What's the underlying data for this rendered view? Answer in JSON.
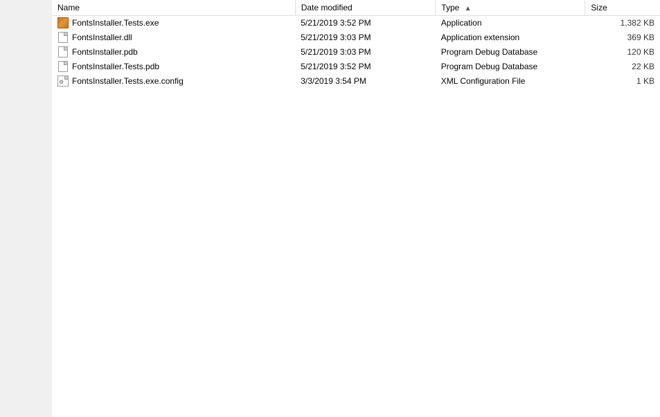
{
  "columns": [
    {
      "id": "name",
      "label": "Name",
      "sortable": true,
      "sorted": false,
      "sort_dir": ""
    },
    {
      "id": "date",
      "label": "Date modified",
      "sortable": true,
      "sorted": false,
      "sort_dir": ""
    },
    {
      "id": "type",
      "label": "Type",
      "sortable": true,
      "sorted": true,
      "sort_dir": "asc"
    },
    {
      "id": "size",
      "label": "Size",
      "sortable": true,
      "sorted": false,
      "sort_dir": ""
    }
  ],
  "files": [
    {
      "name": "FontsInstaller.Tests.exe",
      "icon": "exe",
      "date": "5/21/2019 3:52 PM",
      "type": "Application",
      "size": "1,382 KB"
    },
    {
      "name": "FontsInstaller.dll",
      "icon": "dll",
      "date": "5/21/2019 3:03 PM",
      "type": "Application extension",
      "size": "369 KB"
    },
    {
      "name": "FontsInstaller.pdb",
      "icon": "pdb",
      "date": "5/21/2019 3:03 PM",
      "type": "Program Debug Database",
      "size": "120 KB"
    },
    {
      "name": "FontsInstaller.Tests.pdb",
      "icon": "pdb",
      "date": "5/21/2019 3:52 PM",
      "type": "Program Debug Database",
      "size": "22 KB"
    },
    {
      "name": "FontsInstaller.Tests.exe.config",
      "icon": "config",
      "date": "3/3/2019 3:54 PM",
      "type": "XML Configuration File",
      "size": "1 KB"
    }
  ]
}
